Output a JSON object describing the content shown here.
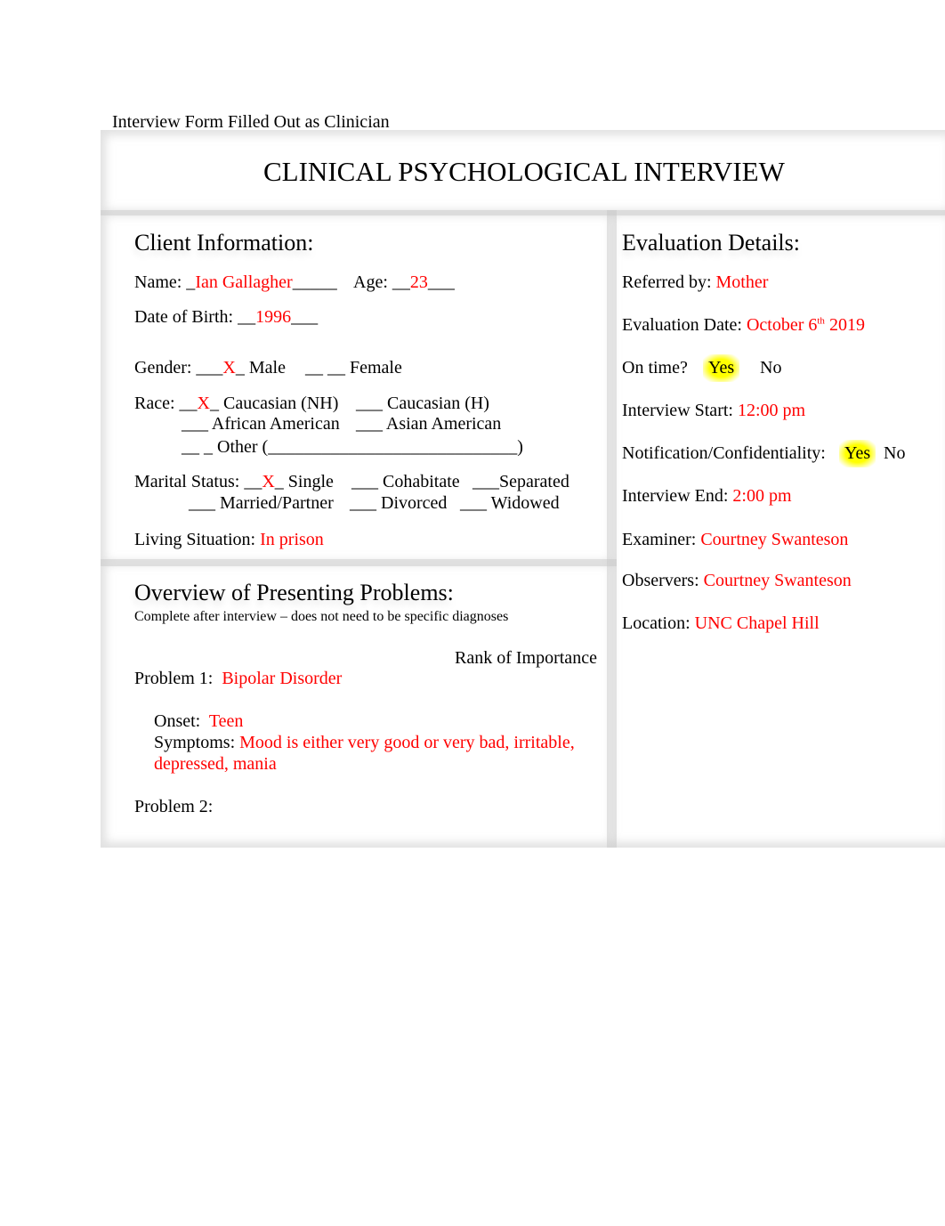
{
  "caption": "Interview Form Filled Out as Clinician",
  "title": "CLINICAL PSYCHOLOGICAL INTERVIEW",
  "client": {
    "heading": "Client Information:",
    "name_label": "Name: _",
    "name": "Ian Gallagher",
    "name_tail": "_____",
    "age_label": "Age: __",
    "age": "23",
    "age_tail": "___",
    "dob_label": "Date of Birth: __",
    "dob": "1996",
    "dob_tail": "___",
    "gender_label": "Gender: ___",
    "gender_mark": "X",
    "gender_male": "_ Male",
    "gender_female": "__ __ Female",
    "race_label": "Race: __",
    "race_mark": "X",
    "race_1": "_ Caucasian (NH)",
    "race_2": "___ Caucasian (H)",
    "race_3": "___ African American",
    "race_4": "___ Asian American",
    "race_5": "__ _ Other (____________________________)",
    "marital_label": "Marital Status: __",
    "marital_mark": "X",
    "marital_1": "_ Single",
    "marital_2": "___ Cohabitate",
    "marital_3": "___Separated",
    "marital_4": "___ Married/Partner",
    "marital_5": "___ Divorced",
    "marital_6": "___ Widowed",
    "living_label": "Living Situation: ",
    "living": "In prison"
  },
  "problems": {
    "heading": "Overview of Presenting Problems:",
    "subtitle": "Complete after interview – does not need to be specific diagnoses",
    "rank_label": "Rank of Importance",
    "p1_label": "Problem 1:",
    "p1": "Bipolar Disorder",
    "onset_label": "Onset:",
    "onset": "Teen",
    "symptoms_label": "Symptoms: ",
    "symptoms_1": "Mood is either very good or very bad, irritable,",
    "symptoms_2": "depressed, mania",
    "p2_label": "Problem 2:"
  },
  "evaluation": {
    "heading": "Evaluation Details:",
    "referred_label": "Referred by: ",
    "referred": "Mother",
    "date_label": "Evaluation Date: ",
    "date_a": "October 6",
    "date_sup": "th",
    "date_b": " 2019",
    "ontime_label": "On time?",
    "ontime_yes": "Yes",
    "ontime_no": "No",
    "start_label": "Interview Start: ",
    "start": "12:00 pm",
    "notif_label": "Notification/Confidentiality:",
    "notif_yes": "Yes",
    "notif_no": "No",
    "end_label": "Interview End: ",
    "end": "2:00 pm",
    "examiner_label": "Examiner: ",
    "examiner": "Courtney Swanteson",
    "observers_label": "Observers: ",
    "observers": "Courtney Swanteson",
    "location_label": "Location: ",
    "location": "UNC Chapel Hill"
  },
  "colors": {
    "filled": "#ff0000",
    "highlight": "#ffff00"
  }
}
